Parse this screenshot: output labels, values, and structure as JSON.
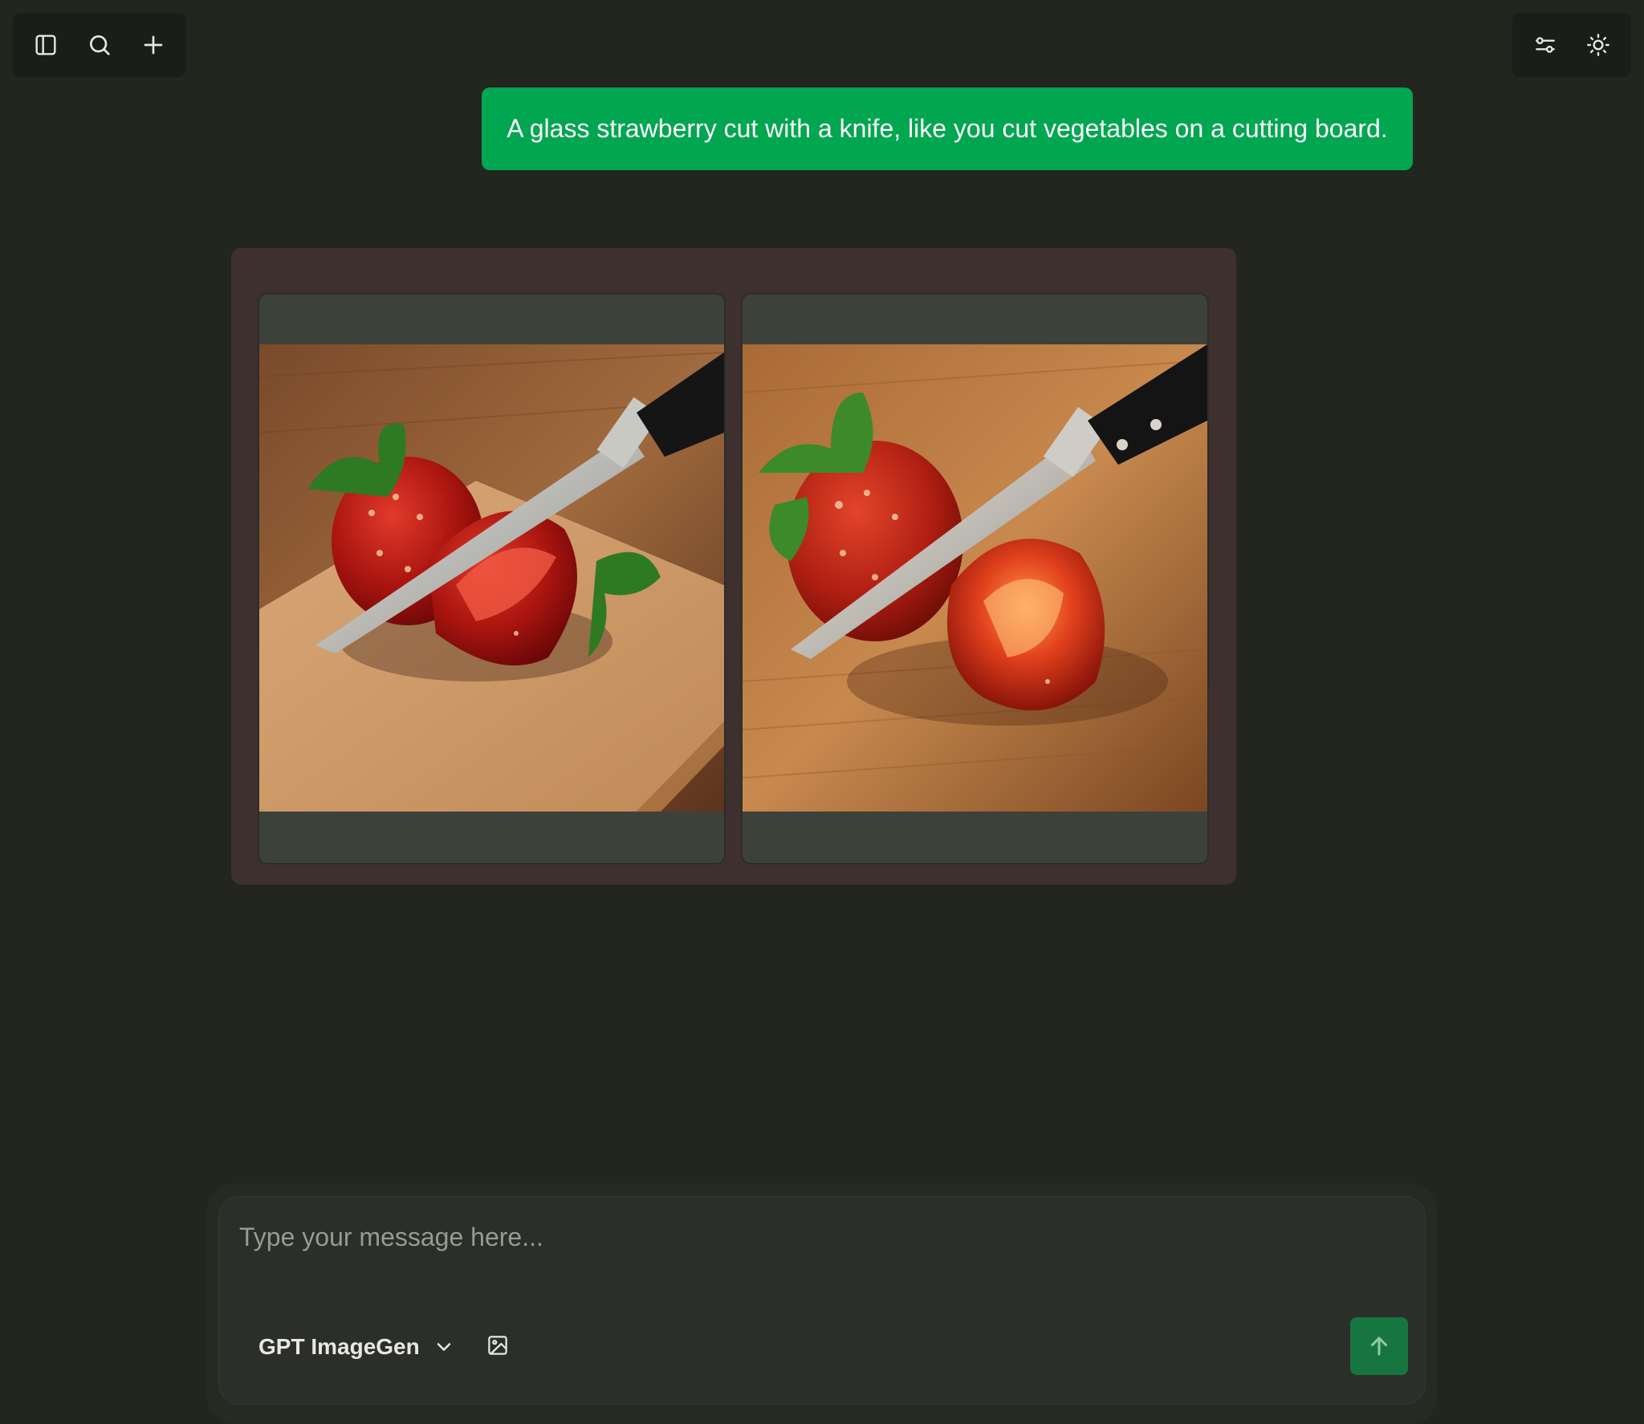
{
  "toolbar": {
    "left_icons": [
      "sidebar-toggle-icon",
      "search-icon",
      "plus-icon"
    ],
    "right_icons": [
      "sliders-icon",
      "sun-icon"
    ]
  },
  "conversation": {
    "user_message": "A glass strawberry cut with a knife, like you cut vegetables on a cutting board.",
    "generated_images": [
      {
        "subject": "glass strawberry being sliced by a chef knife on a light wooden cutting board"
      },
      {
        "subject": "glass strawberry being sliced by a chef knife on a wooden surface"
      }
    ]
  },
  "composer": {
    "placeholder": "Type your message here...",
    "model_label": "GPT ImageGen",
    "attach_icon": "image-icon",
    "send_icon": "arrow-up-icon"
  },
  "colors": {
    "background": "#22261f",
    "user_bubble": "#00a650",
    "gallery_bg": "#3d302e",
    "card_bg": "#3c4139",
    "send_button": "#17753f"
  }
}
